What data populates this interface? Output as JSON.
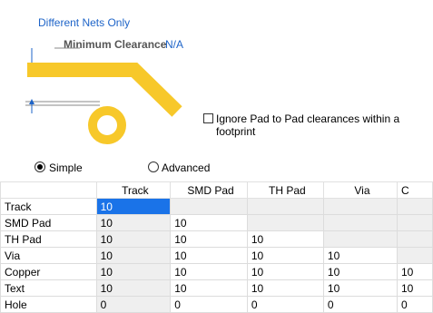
{
  "mode_label": "Different Nets Only",
  "diagram": {
    "title": "Minimum Clearance",
    "value": "N/A"
  },
  "ignore_pad_checkbox": {
    "label": "Ignore Pad to Pad clearances within a footprint",
    "checked": false
  },
  "radios": {
    "simple": "Simple",
    "advanced": "Advanced",
    "selected": "simple"
  },
  "table": {
    "columns": [
      "",
      "Track",
      "SMD Pad",
      "TH Pad",
      "Via",
      "C"
    ],
    "rows": [
      {
        "label": "Track",
        "cells": [
          "10",
          "",
          "",
          "",
          ""
        ]
      },
      {
        "label": "SMD Pad",
        "cells": [
          "10",
          "10",
          "",
          "",
          ""
        ]
      },
      {
        "label": "TH Pad",
        "cells": [
          "10",
          "10",
          "10",
          "",
          ""
        ]
      },
      {
        "label": "Via",
        "cells": [
          "10",
          "10",
          "10",
          "10",
          ""
        ]
      },
      {
        "label": "Copper",
        "cells": [
          "10",
          "10",
          "10",
          "10",
          "10"
        ]
      },
      {
        "label": "Text",
        "cells": [
          "10",
          "10",
          "10",
          "10",
          "10"
        ]
      },
      {
        "label": "Hole",
        "cells": [
          "0",
          "0",
          "0",
          "0",
          "0"
        ]
      }
    ]
  },
  "colors": {
    "accent": "#1e64c8",
    "track": "#f7c82a",
    "selection": "#1a73e8"
  }
}
